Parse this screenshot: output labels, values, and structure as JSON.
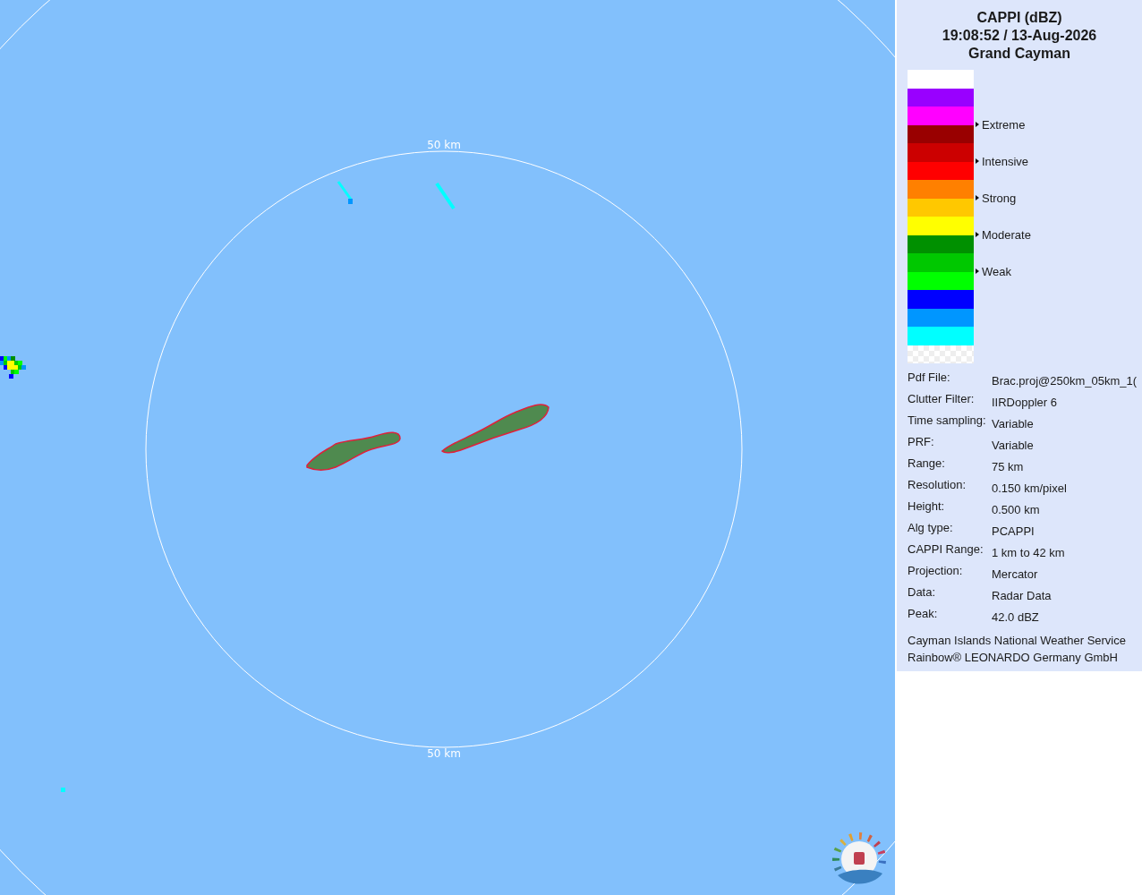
{
  "map": {
    "range_labels": [
      "50 km",
      "50 km"
    ]
  },
  "legend": {
    "title": "CAPPI (dBZ)",
    "time": "19:08:52 / 13-Aug-2026",
    "site": "Grand Cayman",
    "bands": [
      {
        "kind": "color",
        "color": "#ffffff"
      },
      {
        "kind": "color",
        "color": "#9900ff"
      },
      {
        "kind": "color",
        "color": "#ff00ff"
      },
      {
        "kind": "color",
        "color": "#990000",
        "label": "Extreme"
      },
      {
        "kind": "color",
        "color": "#cc0000"
      },
      {
        "kind": "color",
        "color": "#ff0000",
        "label": "Intensive"
      },
      {
        "kind": "color",
        "color": "#ff8000"
      },
      {
        "kind": "color",
        "color": "#ffc800",
        "label": "Strong"
      },
      {
        "kind": "color",
        "color": "#ffff00"
      },
      {
        "kind": "color",
        "color": "#009000",
        "label": "Moderate"
      },
      {
        "kind": "color",
        "color": "#00c800"
      },
      {
        "kind": "color",
        "color": "#00ff00",
        "label": "Weak"
      },
      {
        "kind": "color",
        "color": "#0000ff"
      },
      {
        "kind": "color",
        "color": "#0096ff"
      },
      {
        "kind": "color",
        "color": "#00ffff"
      },
      {
        "kind": "checker"
      }
    ]
  },
  "info": [
    {
      "label": "Pdf File:",
      "value": "Brac.proj@250km_05km_1("
    },
    {
      "label": "Clutter Filter:",
      "value": "IIRDoppler 6"
    },
    {
      "label": "Time sampling:",
      "value": "Variable"
    },
    {
      "label": "PRF:",
      "value": "Variable"
    },
    {
      "label": "Range:",
      "value": "75 km"
    },
    {
      "label": "Resolution:",
      "value": "0.150 km/pixel"
    },
    {
      "label": "Height:",
      "value": "0.500 km"
    },
    {
      "label": "Alg type:",
      "value": "PCAPPI"
    },
    {
      "label": "CAPPI Range:",
      "value": "1 km to 42 km"
    },
    {
      "label": "Projection:",
      "value": "Mercator"
    },
    {
      "label": "Data:",
      "value": "Radar Data"
    },
    {
      "label": "Peak:",
      "value": "42.0 dBZ"
    }
  ],
  "footer": [
    "Cayman Islands National Weather Service",
    "Rainbow® LEONARDO Germany GmbH"
  ]
}
